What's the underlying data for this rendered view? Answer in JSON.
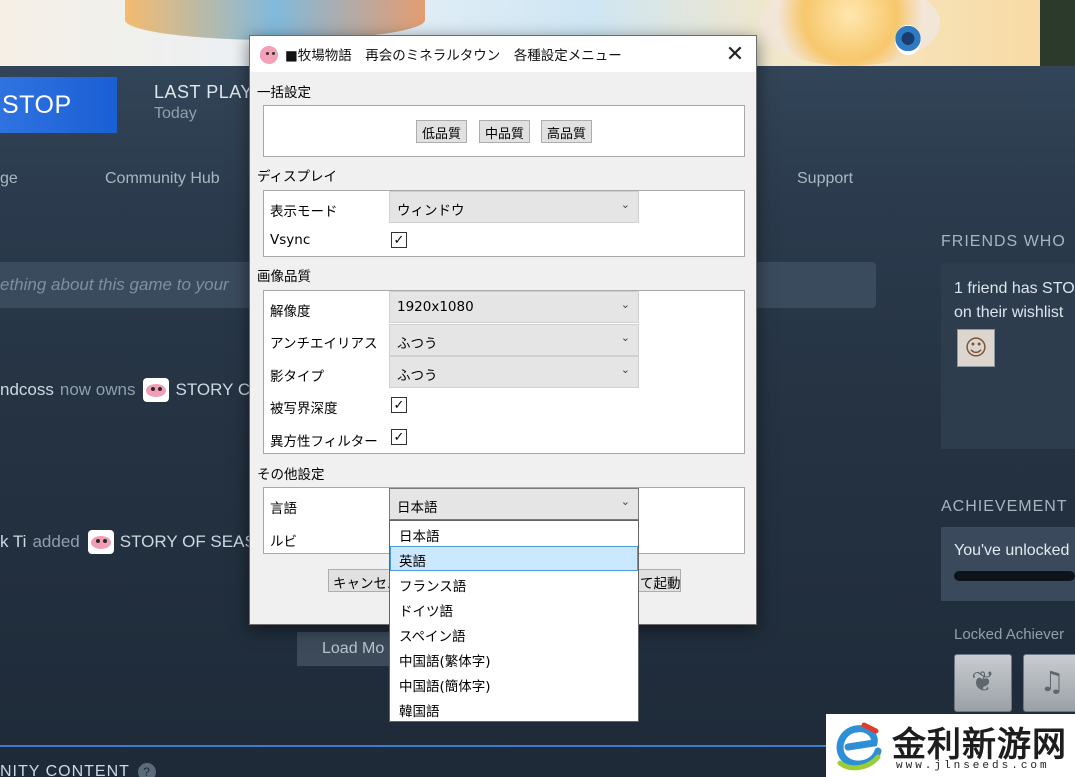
{
  "background": {
    "play_button": "STOP",
    "last_played": {
      "label": "LAST PLAYED",
      "value": "Today"
    },
    "nav": [
      "ge",
      "Community Hub",
      "Support"
    ],
    "share_placeholder": "ething about this game to your",
    "activity": [
      {
        "user": "ndcoss",
        "verb": "now owns",
        "game": "STORY C"
      },
      {
        "user": "k Ti",
        "verb": "added",
        "game": "STORY OF SEAS"
      }
    ],
    "load_more": "Load Mo",
    "community_content": "NITY CONTENT",
    "community_help": "?",
    "friends": {
      "title": "FRIENDS WHO",
      "text_line1": "1 friend has STO",
      "text_line2": "on their wishlist"
    },
    "achievements": {
      "title": "ACHIEVEMENT",
      "unlocked_text": "You've unlocked",
      "locked_label": "Locked Achiever"
    }
  },
  "dialog": {
    "title": "■牧場物語　再会のミネラルタウン　各種設定メニュー",
    "close_glyph": "✕",
    "group_batch": {
      "label": "一括設定",
      "buttons": [
        "低品質",
        "中品質",
        "高品質"
      ]
    },
    "group_display": {
      "label": "ディスプレイ",
      "display_mode_label": "表示モード",
      "display_mode_value": "ウィンドウ",
      "vsync_label": "Vsync",
      "vsync_checked": "✓"
    },
    "group_quality": {
      "label": "画像品質",
      "resolution_label": "解像度",
      "resolution_value": "1920x1080",
      "antialias_label": "アンチエイリアス",
      "antialias_value": "ふつう",
      "shadow_label": "影タイプ",
      "shadow_value": "ふつう",
      "dof_label": "被写界深度",
      "dof_checked": "✓",
      "aniso_label": "異方性フィルター",
      "aniso_checked": "✓"
    },
    "group_other": {
      "label": "その他設定",
      "language_label": "言語",
      "language_value": "日本語",
      "ruby_label": "ルビ"
    },
    "footer": {
      "cancel": "キャンセル",
      "launch_partial": "て起動"
    },
    "chevron": "⌄"
  },
  "language_dropdown": {
    "options": [
      "日本語",
      "英語",
      "フランス語",
      "ドイツ語",
      "スペイン語",
      "中国語(繁体字)",
      "中国語(簡体字)",
      "韓国語"
    ],
    "highlighted": "英語"
  },
  "watermark": {
    "name": "金利新游网",
    "url": "www.jlnseeds.com"
  }
}
